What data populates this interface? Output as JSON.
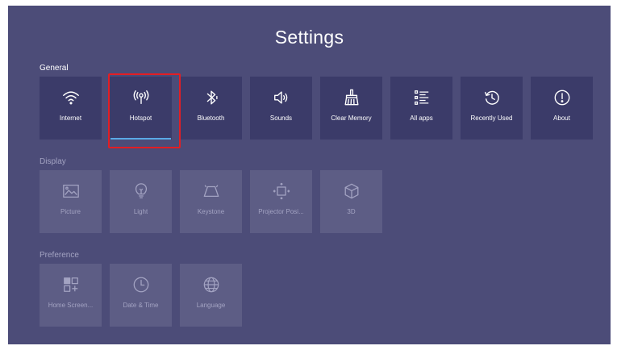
{
  "title": "Settings",
  "sections": {
    "general": {
      "label": "General",
      "items": [
        {
          "label": "Internet",
          "icon": "wifi-icon"
        },
        {
          "label": "Hotspot",
          "icon": "hotspot-icon"
        },
        {
          "label": "Bluetooth",
          "icon": "bluetooth-icon"
        },
        {
          "label": "Sounds",
          "icon": "speaker-icon"
        },
        {
          "label": "Clear Memory",
          "icon": "broom-icon"
        },
        {
          "label": "All apps",
          "icon": "list-icon"
        },
        {
          "label": "Recently Used",
          "icon": "history-icon"
        },
        {
          "label": "About",
          "icon": "info-icon"
        }
      ]
    },
    "display": {
      "label": "Display",
      "items": [
        {
          "label": "Picture",
          "icon": "picture-icon"
        },
        {
          "label": "Light",
          "icon": "lightbulb-icon"
        },
        {
          "label": "Keystone",
          "icon": "keystone-icon"
        },
        {
          "label": "Projector Posi...",
          "icon": "projector-position-icon"
        },
        {
          "label": "3D",
          "icon": "cube-3d-icon"
        }
      ]
    },
    "preference": {
      "label": "Preference",
      "items": [
        {
          "label": "Home Screen...",
          "icon": "home-screen-icon"
        },
        {
          "label": "Date & Time",
          "icon": "clock-icon"
        },
        {
          "label": "Language",
          "icon": "globe-icon"
        }
      ]
    }
  },
  "selected_item": "Hotspot",
  "colors": {
    "background": "#4c4c78",
    "tile": "#3b3b69",
    "tile_dimmed": "#5d5d85",
    "focus_outline": "#e31e24",
    "selected_underline": "#5aa9e6"
  }
}
